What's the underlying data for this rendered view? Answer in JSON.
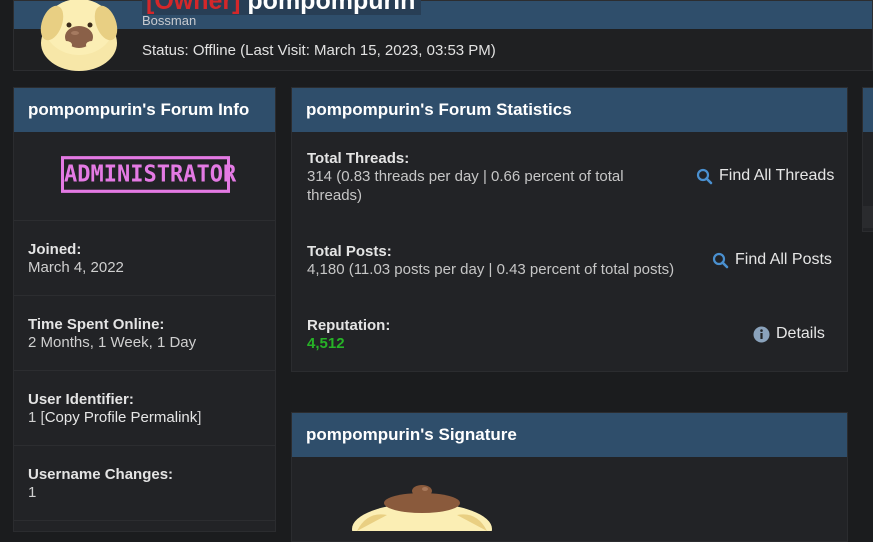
{
  "header": {
    "usergroup": "[Owner]",
    "username": "pompompurin",
    "usertitle": "Bossman",
    "status_prefix": "Status: ",
    "status_value": "Offline",
    "last_visit": " (Last Visit: March 15, 2023, 03:53 PM)"
  },
  "forum_info": {
    "title": "pompompurin's Forum Info",
    "role_badge": "ADMINISTRATOR",
    "joined_label": "Joined:",
    "joined_value": "March 4, 2022",
    "online_label": "Time Spent Online:",
    "online_value": "2 Months, 1 Week, 1 Day",
    "uid_label": "User Identifier:",
    "uid_value": "1",
    "uid_link": "Copy Profile Permalink",
    "username_changes_label": "Username Changes:",
    "username_changes_value": "1"
  },
  "stats": {
    "title": "pompompurin's Forum Statistics",
    "threads_label": "Total Threads:",
    "threads_value": "314 (0.83 threads per day | 0.66 percent of total threads)",
    "threads_button": "Find All Threads",
    "posts_label": "Total Posts:",
    "posts_value": "4,180 (11.03 posts per day | 0.43 percent of total posts)",
    "posts_button": "Find All Posts",
    "rep_label": "Reputation:",
    "rep_value": "4,512",
    "rep_button": "Details"
  },
  "signature": {
    "title": "pompompurin's Signature"
  },
  "colors": {
    "header_blue": "#2f4e6b",
    "admin_badge": "#e47ae4",
    "owner_red": "#d4272a",
    "reputation_green": "#27b327"
  }
}
